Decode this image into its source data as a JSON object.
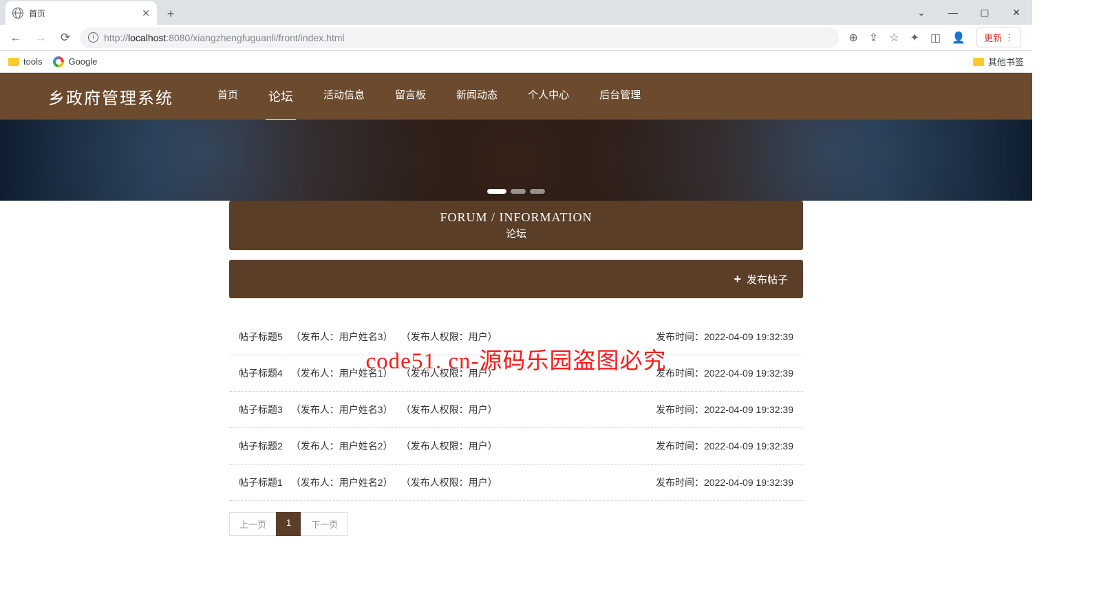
{
  "browser": {
    "tab_title": "首页",
    "url_prefix": "http://",
    "url_host": "localhost",
    "url_port": ":8080",
    "url_path": "/xiangzhengfuguanli/front/index.html",
    "update_label": "更新",
    "bookmarks": {
      "tools": "tools",
      "google": "Google",
      "other": "其他书签"
    }
  },
  "header": {
    "logo": "乡政府管理系统",
    "nav": [
      "首页",
      "论坛",
      "活动信息",
      "留言板",
      "新闻动态",
      "个人中心",
      "后台管理"
    ],
    "active_index": 1
  },
  "section": {
    "title_en": "FORUM / INFORMATION",
    "title_cn": "论坛",
    "post_btn": "发布帖子"
  },
  "watermark": "code51. cn-源码乐园盗图必究",
  "posts": [
    {
      "title": "帖子标题5",
      "author": "（发布人：用户姓名3）",
      "perm": "（发布人权限：用户）",
      "time_label": "发布时间：",
      "time": "2022-04-09 19:32:39"
    },
    {
      "title": "帖子标题4",
      "author": "（发布人：用户姓名1）",
      "perm": "（发布人权限：用户）",
      "time_label": "发布时间：",
      "time": "2022-04-09 19:32:39"
    },
    {
      "title": "帖子标题3",
      "author": "（发布人：用户姓名3）",
      "perm": "（发布人权限：用户）",
      "time_label": "发布时间：",
      "time": "2022-04-09 19:32:39"
    },
    {
      "title": "帖子标题2",
      "author": "（发布人：用户姓名2）",
      "perm": "（发布人权限：用户）",
      "time_label": "发布时间：",
      "time": "2022-04-09 19:32:39"
    },
    {
      "title": "帖子标题1",
      "author": "（发布人：用户姓名2）",
      "perm": "（发布人权限：用户）",
      "time_label": "发布时间：",
      "time": "2022-04-09 19:32:39"
    }
  ],
  "pagination": {
    "prev": "上一页",
    "page": "1",
    "next": "下一页"
  }
}
